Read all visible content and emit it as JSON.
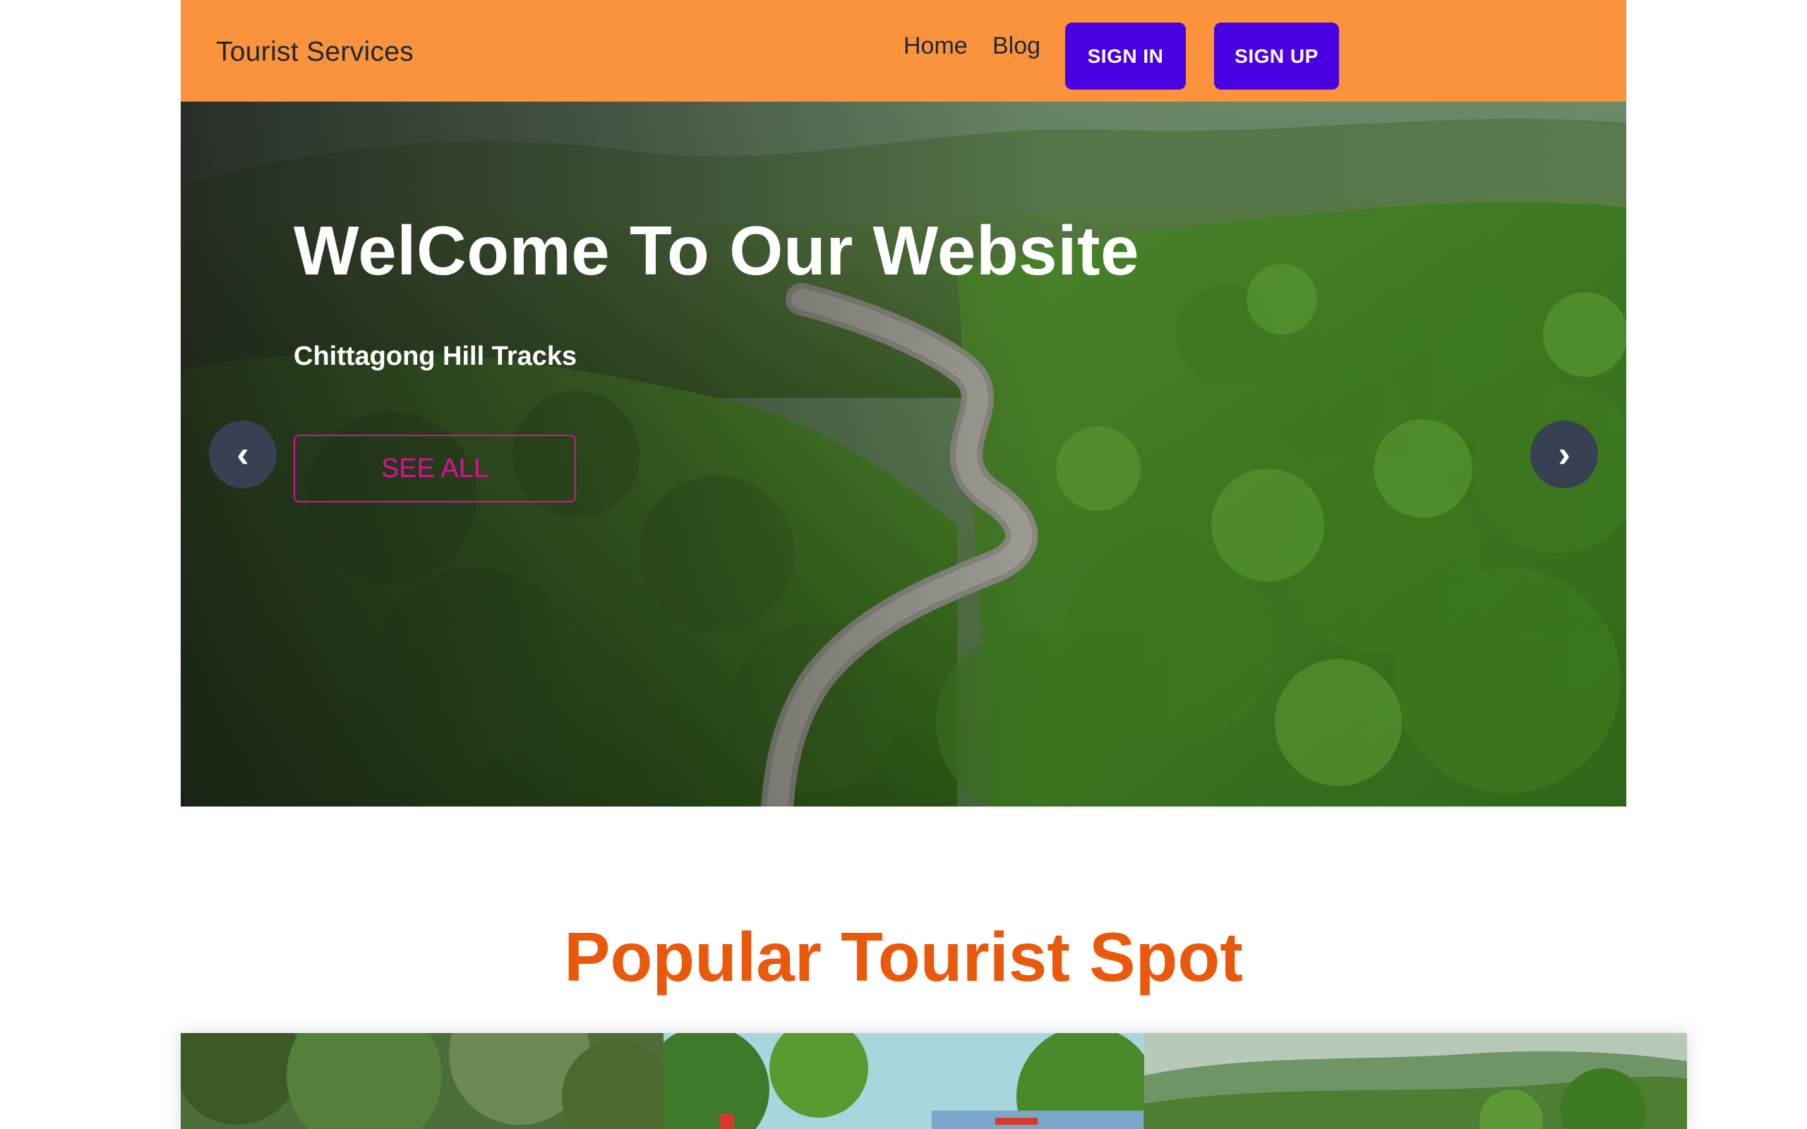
{
  "navbar": {
    "brand": "Tourist Services",
    "links": [
      {
        "label": "Home"
      },
      {
        "label": "Blog"
      }
    ],
    "sign_in_label": "SIGN IN",
    "sign_up_label": "SIGN UP"
  },
  "hero": {
    "title": "WelCome To Our Website",
    "subtitle": "Chittagong Hill Tracks",
    "cta_label": "SEE ALL",
    "prev_glyph": "‹",
    "next_glyph": "›"
  },
  "popular": {
    "title": "Popular Tourist Spot"
  },
  "colors": {
    "nav_bg": "#fb923c",
    "auth_button": "#4a00e0",
    "accent_pink": "#e30b9f",
    "section_title": "#ea580c",
    "carousel_btn": "#374151"
  },
  "icons": {
    "prev": "chevron-left-icon",
    "next": "chevron-right-icon"
  }
}
